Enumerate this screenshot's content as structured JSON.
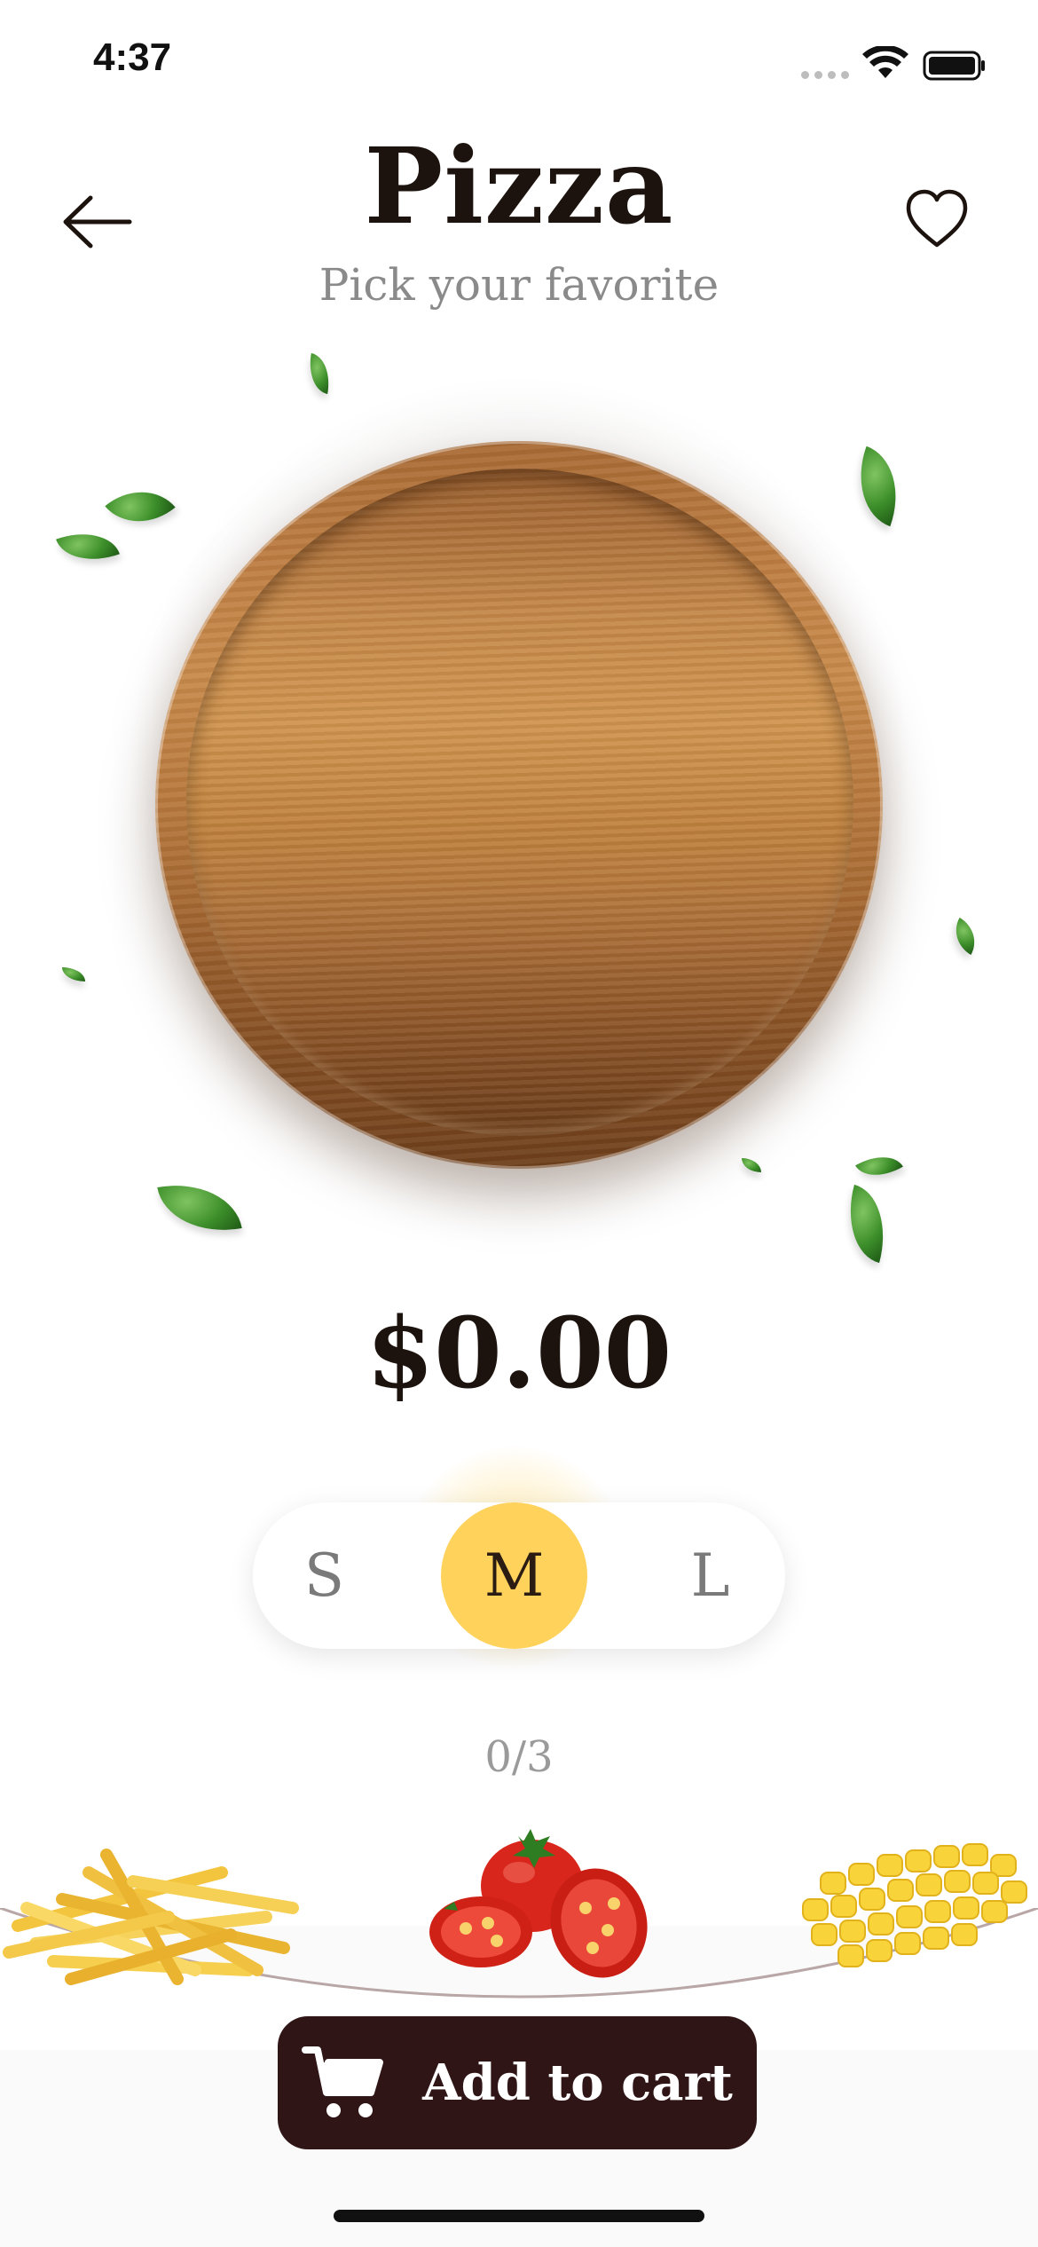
{
  "status_bar": {
    "time": "4:37"
  },
  "header": {
    "title": "Pizza",
    "subtitle": "Pick your favorite"
  },
  "price": "$0.00",
  "size_selector": {
    "options": [
      "S",
      "M",
      "L"
    ],
    "selected": "M"
  },
  "ingredients": {
    "counter": "0/3",
    "items": [
      {
        "name": "fries",
        "icon": "fries-icon"
      },
      {
        "name": "tomato",
        "icon": "tomato-icon"
      },
      {
        "name": "corn",
        "icon": "corn-icon"
      }
    ]
  },
  "cart_button": {
    "label": "Add to cart"
  },
  "colors": {
    "accent": "#ffd25c",
    "button": "#301516",
    "title": "#1d130e"
  }
}
